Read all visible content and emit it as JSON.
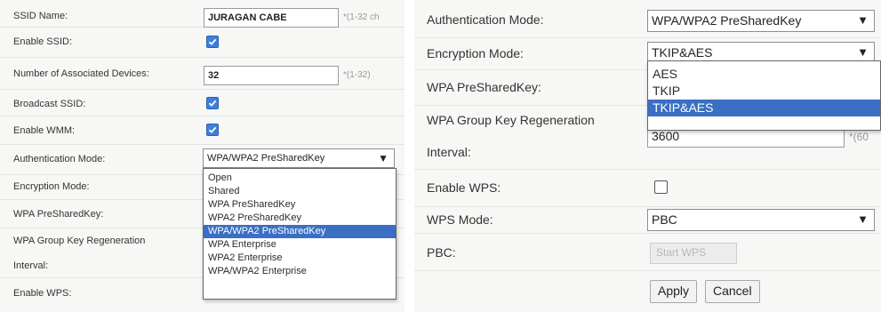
{
  "left": {
    "ssid_name_label": "SSID Name:",
    "ssid_name_value": "JURAGAN CABE",
    "ssid_name_hint": "*(1-32 ch",
    "enable_ssid_label": "Enable SSID:",
    "assoc_devices_label": "Number of Associated Devices:",
    "assoc_devices_value": "32",
    "assoc_devices_hint": "*(1-32)",
    "broadcast_ssid_label": "Broadcast SSID:",
    "enable_wmm_label": "Enable WMM:",
    "auth_mode_label": "Authentication Mode:",
    "auth_mode_value": "WPA/WPA2 PreSharedKey",
    "encryption_mode_label": "Encryption Mode:",
    "wpa_psk_label": "WPA PreSharedKey:",
    "wpa_group_key_label": "WPA Group Key Regeneration",
    "interval_label": "Interval:",
    "enable_wps_label": "Enable WPS:",
    "auth_options": [
      "Open",
      "Shared",
      "WPA PreSharedKey",
      "WPA2 PreSharedKey",
      "WPA/WPA2 PreSharedKey",
      "WPA Enterprise",
      "WPA2 Enterprise",
      "WPA/WPA2 Enterprise"
    ],
    "auth_highlighted_index": 4
  },
  "right": {
    "auth_mode_label": "Authentication Mode:",
    "auth_mode_value": "WPA/WPA2 PreSharedKey",
    "encryption_mode_label": "Encryption Mode:",
    "encryption_mode_value": "TKIP&AES",
    "wpa_psk_label": "WPA PreSharedKey:",
    "wpa_group_key_label": "WPA Group Key Regeneration",
    "interval_label": "Interval:",
    "interval_value": "3600",
    "interval_hint": "*(60",
    "enable_wps_label": "Enable WPS:",
    "wps_mode_label": "WPS Mode:",
    "wps_mode_value": "PBC",
    "pbc_label": "PBC:",
    "pbc_button": "Start WPS",
    "apply_button": "Apply",
    "cancel_button": "Cancel",
    "enc_options": [
      "AES",
      "TKIP",
      "TKIP&AES"
    ],
    "enc_highlighted_index": 2
  },
  "colors": {
    "checkbox_checked": "#3d7fd9",
    "highlight": "#3a6fc4",
    "panel_bg": "#f7f7f5"
  }
}
